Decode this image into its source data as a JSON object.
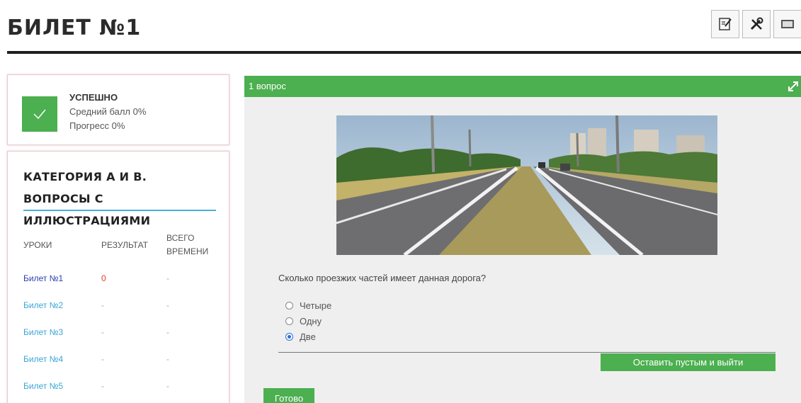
{
  "page": {
    "title": "БИЛЕТ №1"
  },
  "toolbar": {
    "icons": [
      "notes-icon",
      "tools-icon",
      "keyboard-icon"
    ]
  },
  "status": {
    "title": "УСПЕШНО",
    "average": "Средний балл 0%",
    "progress": "Прогресс 0%",
    "icon": "checkmark-icon",
    "color": "#4caf50"
  },
  "category": {
    "title": "КАТЕГОРИЯ А И В. ВОПРОСЫ С ИЛЛЮСТРАЦИЯМИ",
    "columns": {
      "lessons": "УРОКИ",
      "result": "РЕЗУЛЬТАТ",
      "total_line1": "ВСЕГО",
      "total_line2": "ВРЕМЕНИ"
    },
    "lessons": [
      {
        "name": "Билет №1",
        "result": "0",
        "time": "-"
      },
      {
        "name": "Билет №2",
        "result": "-",
        "time": "-"
      },
      {
        "name": "Билет №3",
        "result": "-",
        "time": "-"
      },
      {
        "name": "Билет №4",
        "result": "-",
        "time": "-"
      },
      {
        "name": "Билет №5",
        "result": "-",
        "time": "-"
      }
    ]
  },
  "question": {
    "header": "1 вопрос",
    "text": "Сколько проезжих частей имеет данная дорога?",
    "answers": [
      {
        "label": "Четыре",
        "selected": false
      },
      {
        "label": "Одну",
        "selected": false
      },
      {
        "label": "Две",
        "selected": true
      }
    ],
    "leave_button": "Оставить пустым и выйти",
    "done_button": "Готово"
  },
  "colors": {
    "accent": "#4caf50",
    "link": "#3aa6d6",
    "active_link": "#2a3fb0",
    "error": "#e53935"
  }
}
